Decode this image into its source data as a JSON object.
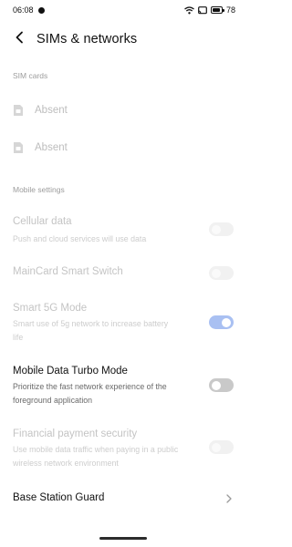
{
  "status_bar": {
    "time": "06:08",
    "battery": "78",
    "icons": [
      "wifi-icon",
      "screen-cast-icon",
      "battery-icon"
    ]
  },
  "header": {
    "title": "SIMs & networks",
    "back_icon": "chevron-left-icon"
  },
  "sim_section": {
    "header": "SIM cards",
    "sims": [
      {
        "label": "Absent",
        "icon": "sim-card-icon"
      },
      {
        "label": "Absent",
        "icon": "sim-card-icon"
      }
    ]
  },
  "mobile_section": {
    "header": "Mobile settings",
    "items": [
      {
        "title": "Cellular data",
        "description": "Push and cloud services will use data",
        "toggle": "off",
        "enabled": false
      },
      {
        "title": "MainCard Smart Switch",
        "description": "",
        "toggle": "off",
        "enabled": false
      },
      {
        "title": "Smart 5G Mode",
        "description": "Smart use of 5g network to increase battery life",
        "toggle": "on",
        "enabled": false
      },
      {
        "title": "Mobile Data Turbo Mode",
        "description": "Prioritize the fast network experience of the foreground application",
        "toggle": "off",
        "enabled": true
      },
      {
        "title": "Financial payment security",
        "description": "Use mobile data traffic when paying in a public wireless network environment",
        "toggle": "off",
        "enabled": false
      },
      {
        "title": "Base Station Guard",
        "description": "",
        "chevron": "chevron-right-icon",
        "enabled": true
      }
    ]
  },
  "colors": {
    "toggle_on_disabled": "#a9c0f2",
    "toggle_off_active": "#c9c9c9",
    "disabled_text": "#c4c4c4",
    "section_header": "#9c9c9c"
  }
}
